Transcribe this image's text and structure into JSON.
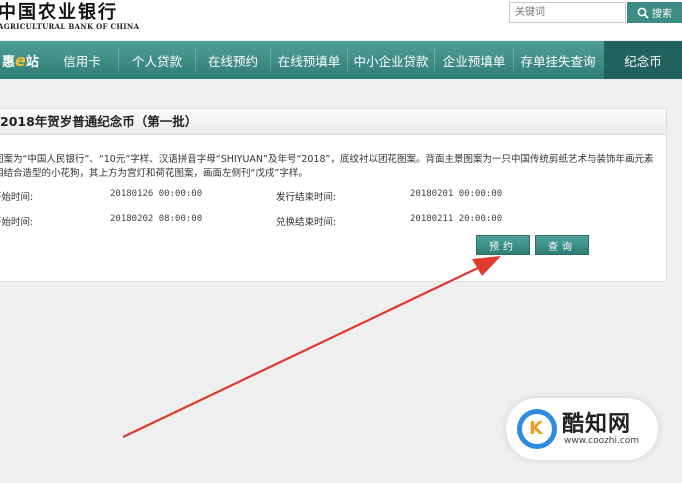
{
  "header": {
    "logo_cn": "中国农业银行",
    "logo_en": "AGRICULTURAL BANK OF CHINA",
    "search_placeholder": "关键词",
    "search_button": "搜索"
  },
  "nav": {
    "brand_prefix": "惠",
    "brand_e": "e",
    "brand_suffix": "站",
    "items": [
      {
        "label": "信用卡"
      },
      {
        "label": "个人贷款"
      },
      {
        "label": "在线预约"
      },
      {
        "label": "在线预填单"
      },
      {
        "label": "中小企业贷款"
      },
      {
        "label": "企业预填单"
      },
      {
        "label": "存单挂失查询"
      },
      {
        "label": "纪念币",
        "active": true
      }
    ]
  },
  "panel": {
    "title": "2018年贺岁普通纪念币（第一批）",
    "description": "图案为“中国人民银行”、“10元”字样、汉语拼音字母“SHIYUAN”及年号“2018”，底纹衬以团花图案。背面主景图案为一只中国传统剪纸艺术与装饰年画元素相结合造型的小花狗，其上方为宫灯和荷花图案，画面左侧刊“戊戌”字样。",
    "rows": [
      {
        "label1": "开始时间:",
        "value1": "20180126 00:00:00",
        "label2": "发行结束时间:",
        "value2": "20180201 00:00:00"
      },
      {
        "label1": "开始时间:",
        "value1": "20180202 08:00:00",
        "label2": "兑换结束时间:",
        "value2": "20180211 20:00:00"
      }
    ],
    "reserve_button": "预约",
    "query_button": "查询"
  },
  "watermark": {
    "title": "酷知网",
    "url": "www.coozhi.com",
    "logo_letter": "K"
  }
}
